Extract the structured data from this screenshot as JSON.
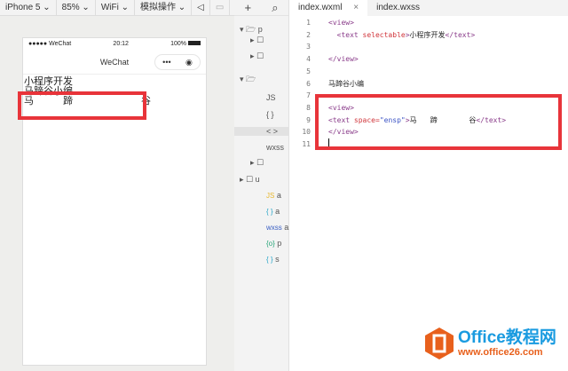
{
  "toolbar": {
    "device": "iPhone 5 ⌄",
    "zoom": "85% ⌄",
    "network": "WiFi ⌄",
    "operation": "模拟操作 ⌄"
  },
  "phone": {
    "carrier": "●●●●● WeChat",
    "time": "20:12",
    "battery": "100%",
    "nav_title": "WeChat",
    "menu": "•••",
    "close": "◉",
    "lines": [
      "小程序开发",
      "马蹄谷小编",
      "马　　　蹄　　　　　　　谷"
    ]
  },
  "tree": {
    "items": [
      "p",
      "",
      "",
      "",
      "JS",
      "{ }",
      "< >",
      "wxss",
      "",
      "u",
      "a",
      "a",
      "a",
      "p",
      "s"
    ],
    "icons": {
      "js": "JS",
      "json": "{ }",
      "wxml": "< >",
      "wxss": "wxss",
      "config": "{o}"
    }
  },
  "editor": {
    "tabs": [
      {
        "label": "index.wxml",
        "close": "×"
      },
      {
        "label": "index.wxss"
      }
    ],
    "lines": [
      {
        "n": "1",
        "parts": [
          [
            "tag",
            "<view>"
          ]
        ]
      },
      {
        "n": "2",
        "parts": [
          [
            "tag",
            "  <text "
          ],
          [
            "attr",
            "selectable"
          ],
          [
            "tag",
            ">"
          ],
          [
            "txt",
            "小程序开发"
          ],
          [
            "tag",
            "</text>"
          ]
        ]
      },
      {
        "n": "3",
        "parts": []
      },
      {
        "n": "4",
        "parts": [
          [
            "tag",
            "</view>"
          ]
        ]
      },
      {
        "n": "5",
        "parts": []
      },
      {
        "n": "6",
        "parts": [
          [
            "txt",
            "马蹄谷小编"
          ]
        ]
      },
      {
        "n": "7",
        "parts": []
      },
      {
        "n": "8",
        "parts": [
          [
            "tag",
            "<view>"
          ]
        ]
      },
      {
        "n": "9",
        "parts": [
          [
            "tag",
            "<text "
          ],
          [
            "attr",
            "space="
          ],
          [
            "str",
            "\"ensp\""
          ],
          [
            "tag",
            ">"
          ],
          [
            "txt",
            "马      蹄              谷"
          ],
          [
            "tag",
            "</text>"
          ]
        ]
      },
      {
        "n": "10",
        "parts": [
          [
            "tag",
            "</view>"
          ]
        ]
      },
      {
        "n": "11",
        "parts": []
      }
    ]
  },
  "watermark": {
    "brand": "Office教程网",
    "url": "www.office26.com"
  },
  "colors": {
    "highlight": "#e8343a",
    "office": "#e8601c",
    "brand_blue": "#1a9be0"
  }
}
